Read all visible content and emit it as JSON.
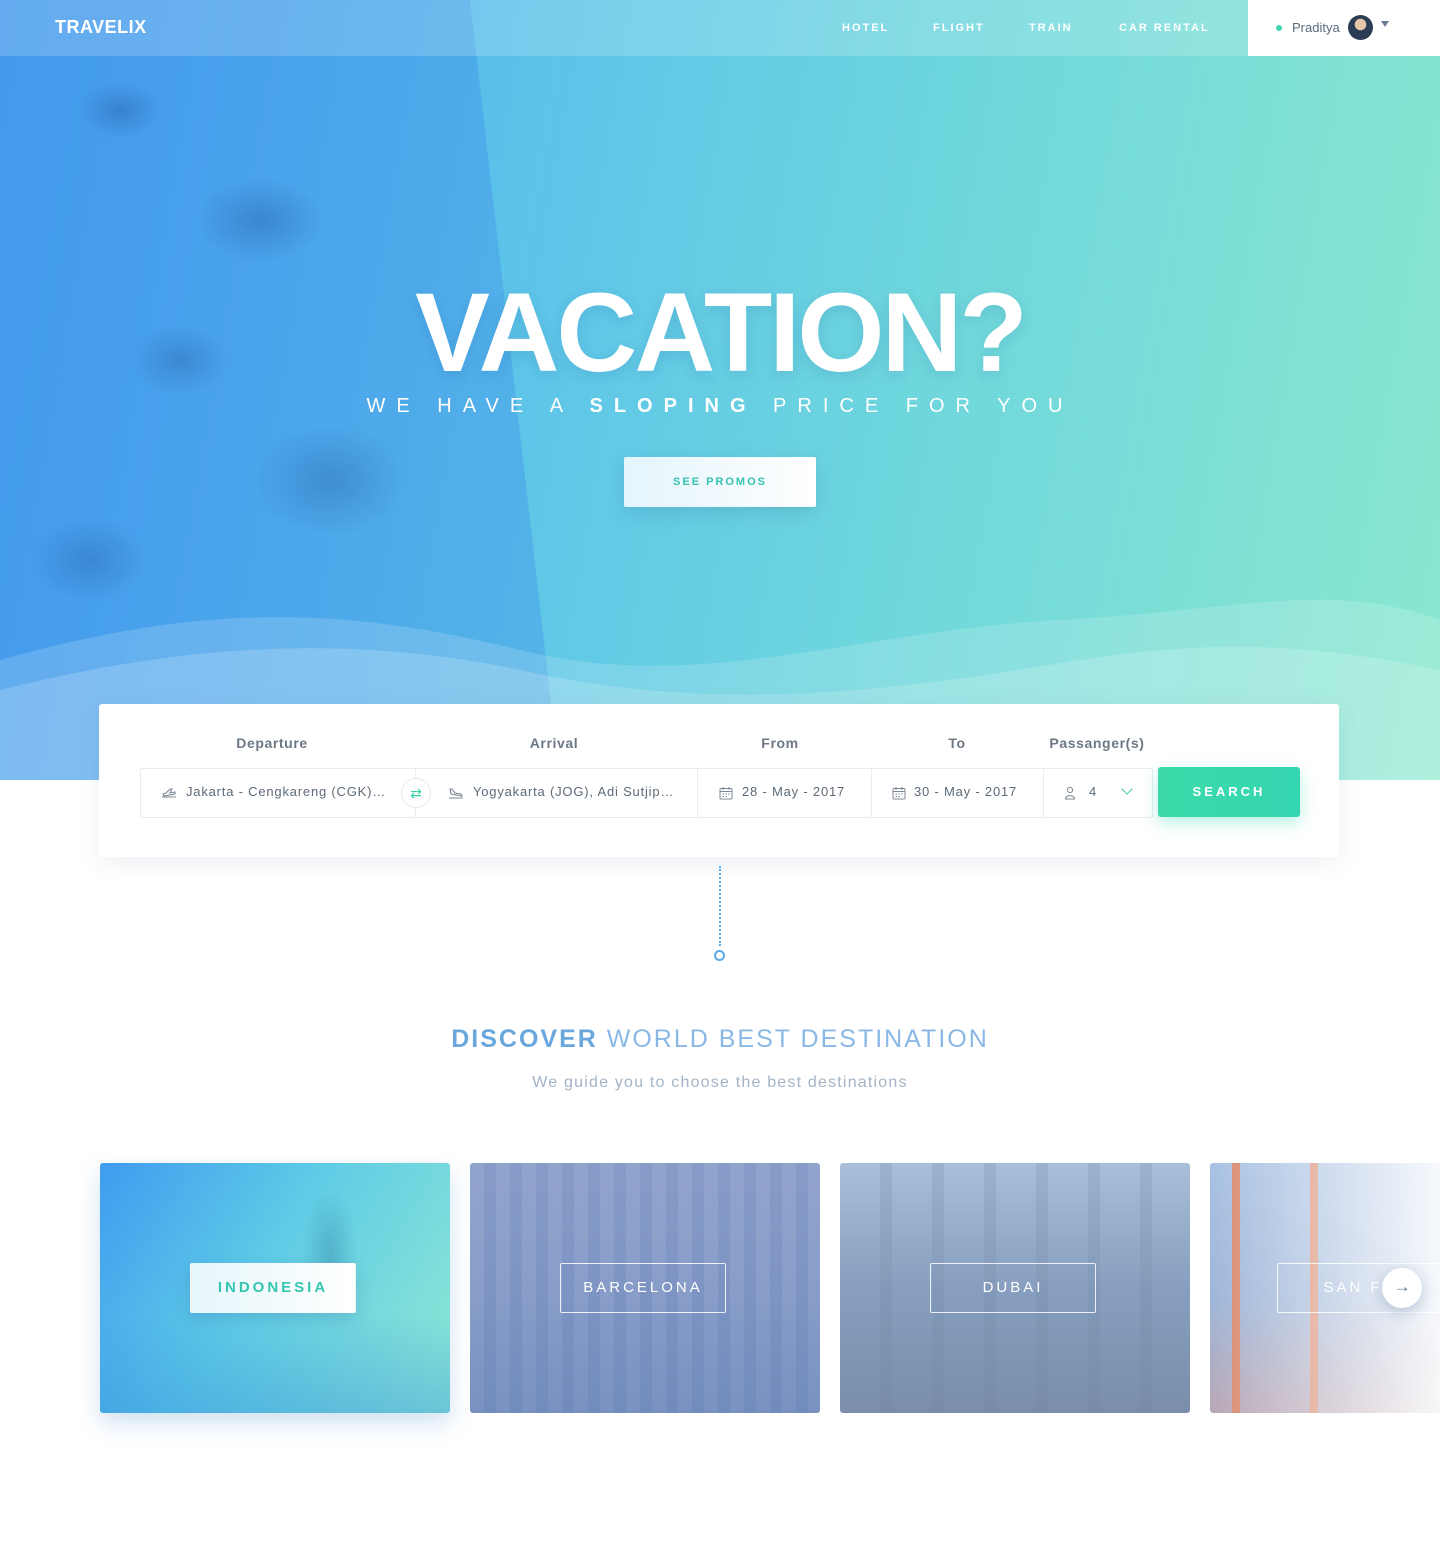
{
  "brand": {
    "logo": "TRAVELIX"
  },
  "nav": {
    "links": [
      "HOTEL",
      "FLIGHT",
      "TRAIN",
      "CAR RENTAL"
    ],
    "user": {
      "name": "Praditya"
    }
  },
  "hero": {
    "title": "VACATION?",
    "subtitle_pre": "WE HAVE A ",
    "subtitle_bold": "SLOPING",
    "subtitle_post": " PRICE FOR YOU",
    "cta": "SEE PROMOS"
  },
  "search": {
    "labels": {
      "departure": "Departure",
      "arrival": "Arrival",
      "from": "From",
      "to": "To",
      "passengers": "Passanger(s)"
    },
    "departure": "Jakarta - Cengkareng (CGK)…",
    "arrival": "Yogyakarta (JOG), Adi Sutjip…",
    "from_date": "28 - May - 2017",
    "to_date": "30 - May - 2017",
    "passengers": "4",
    "button": "SEARCH"
  },
  "discover": {
    "title_bold": "DISCOVER",
    "title_rest": " WORLD BEST DESTINATION",
    "subtitle": "We guide you to choose the best destinations",
    "destinations": [
      "INDONESIA",
      "BARCELONA",
      "DUBAI",
      "SAN FR"
    ]
  },
  "colors": {
    "accent": "#36d1a8",
    "blue": "#5ba8e6",
    "hero_start": "#3f9cf0",
    "hero_end": "#8ae8cf"
  },
  "icons": [
    "departure-plane-icon",
    "swap-icon",
    "arrival-plane-icon",
    "calendar-icon",
    "person-icon",
    "chevron-down-icon",
    "caret-down-icon",
    "arrow-right-icon"
  ]
}
